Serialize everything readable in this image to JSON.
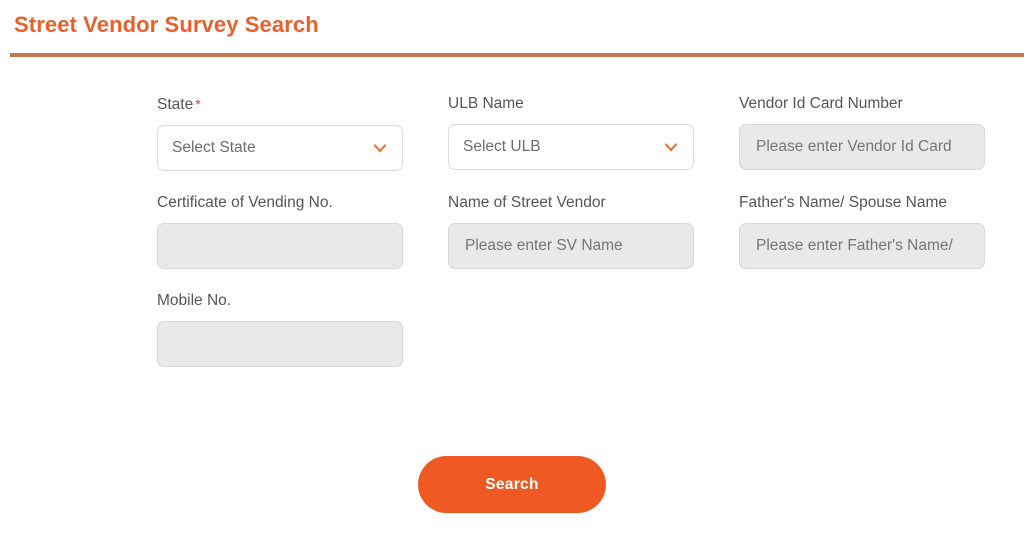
{
  "header": {
    "title": "Street Vendor Survey Search",
    "title_color": "#e8602c",
    "divider_color": "#c57a4e"
  },
  "form": {
    "fields": [
      {
        "label": "State",
        "required": true,
        "required_marker": "*",
        "type": "select",
        "value": "Select State",
        "icon": "chevron-down-icon",
        "name": "state"
      },
      {
        "label": "ULB Name",
        "required": false,
        "required_marker": "",
        "type": "select",
        "value": "Select ULB",
        "icon": "chevron-down-icon",
        "name": "ulb-name"
      },
      {
        "label": "Vendor Id Card Number",
        "required": false,
        "required_marker": "",
        "type": "input",
        "value": "",
        "placeholder": "Please enter Vendor Id Card",
        "name": "vendor-id-card-number"
      },
      {
        "label": "Certificate of Vending No.",
        "required": false,
        "required_marker": "",
        "type": "input",
        "value": "",
        "placeholder": "",
        "name": "certificate-of-vending-no"
      },
      {
        "label": "Name of Street Vendor",
        "required": false,
        "required_marker": "",
        "type": "input",
        "value": "",
        "placeholder": "Please enter SV Name",
        "name": "name-of-street-vendor"
      },
      {
        "label": "Father's Name/ Spouse Name",
        "required": false,
        "required_marker": "",
        "type": "input",
        "value": "",
        "placeholder": "Please enter Father's Name/",
        "name": "fathers-name-spouse-name"
      },
      {
        "label": "Mobile No.",
        "required": false,
        "required_marker": "",
        "type": "input",
        "value": "",
        "placeholder": "",
        "name": "mobile-no"
      }
    ]
  },
  "actions": {
    "search_label": "Search",
    "search_color": "#ef5a22"
  }
}
